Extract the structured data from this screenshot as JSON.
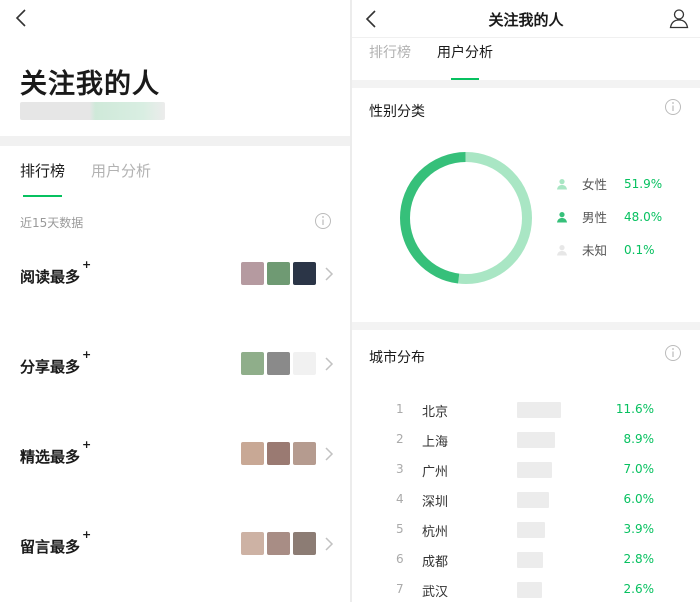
{
  "left": {
    "title": "关注我的人",
    "tabs": [
      {
        "label": "排行榜",
        "active": true
      },
      {
        "label": "用户分析",
        "active": false
      }
    ],
    "period_note": "近15天数据",
    "rankings": [
      {
        "label": "阅读最多",
        "plus": "+",
        "avatar_colors": [
          "#b59aa0",
          "#6f9a73",
          "#2b3547"
        ]
      },
      {
        "label": "分享最多",
        "plus": "+",
        "avatar_colors": [
          "#8fae8a",
          "#8a8a8a",
          "#f1f1f1"
        ]
      },
      {
        "label": "精选最多",
        "plus": "+",
        "avatar_colors": [
          "#c8a895",
          "#9a7a72",
          "#b59b8f"
        ]
      },
      {
        "label": "留言最多",
        "plus": "+",
        "avatar_colors": [
          "#cdb2a4",
          "#a88d85",
          "#8c7c74"
        ]
      }
    ]
  },
  "right": {
    "header_title": "关注我的人",
    "tabs": [
      {
        "label": "排行榜",
        "active": false
      },
      {
        "label": "用户分析",
        "active": true
      }
    ],
    "gender_title": "性别分类",
    "gender": [
      {
        "label": "女性",
        "percent": "51.9%",
        "value": 51.9,
        "color": "#a9e6c4"
      },
      {
        "label": "男性",
        "percent": "48.0%",
        "value": 48.0,
        "color": "#36c07a"
      },
      {
        "label": "未知",
        "percent": "0.1%",
        "value": 0.1,
        "color": "#e7e7e7"
      }
    ],
    "city_title": "城市分布",
    "cities": [
      {
        "rank": "1",
        "name": "北京",
        "percent": "11.6%",
        "value": 11.6
      },
      {
        "rank": "2",
        "name": "上海",
        "percent": "8.9%",
        "value": 8.9
      },
      {
        "rank": "3",
        "name": "广州",
        "percent": "7.0%",
        "value": 7.0
      },
      {
        "rank": "4",
        "name": "深圳",
        "percent": "6.0%",
        "value": 6.0
      },
      {
        "rank": "5",
        "name": "杭州",
        "percent": "3.9%",
        "value": 3.9
      },
      {
        "rank": "6",
        "name": "成都",
        "percent": "2.8%",
        "value": 2.8
      },
      {
        "rank": "7",
        "name": "武汉",
        "percent": "2.6%",
        "value": 2.6
      }
    ],
    "accent": "#07c160"
  }
}
